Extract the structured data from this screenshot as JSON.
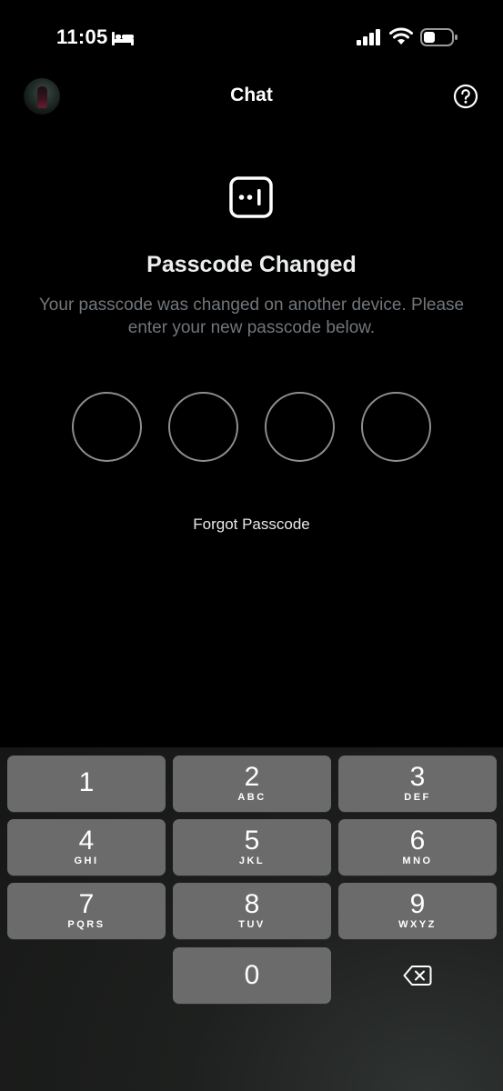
{
  "status_bar": {
    "time": "11:05"
  },
  "header": {
    "title": "Chat"
  },
  "lock": {
    "title": "Passcode Changed",
    "description": "Your passcode was changed on another device. Please enter your new passcode below.",
    "forgot_label": "Forgot Passcode"
  },
  "keypad": {
    "keys": [
      {
        "digit": "1",
        "letters": ""
      },
      {
        "digit": "2",
        "letters": "ABC"
      },
      {
        "digit": "3",
        "letters": "DEF"
      },
      {
        "digit": "4",
        "letters": "GHI"
      },
      {
        "digit": "5",
        "letters": "JKL"
      },
      {
        "digit": "6",
        "letters": "MNO"
      },
      {
        "digit": "7",
        "letters": "PQRS"
      },
      {
        "digit": "8",
        "letters": "TUV"
      },
      {
        "digit": "9",
        "letters": "WXYZ"
      },
      {
        "digit": "0",
        "letters": ""
      }
    ]
  },
  "icons": {
    "status": [
      "bed-icon",
      "signal-icon",
      "wifi-icon",
      "battery-icon"
    ],
    "header": [
      "avatar",
      "help-icon"
    ],
    "content": [
      "lock-icon"
    ],
    "keypad": [
      "backspace-icon"
    ]
  }
}
